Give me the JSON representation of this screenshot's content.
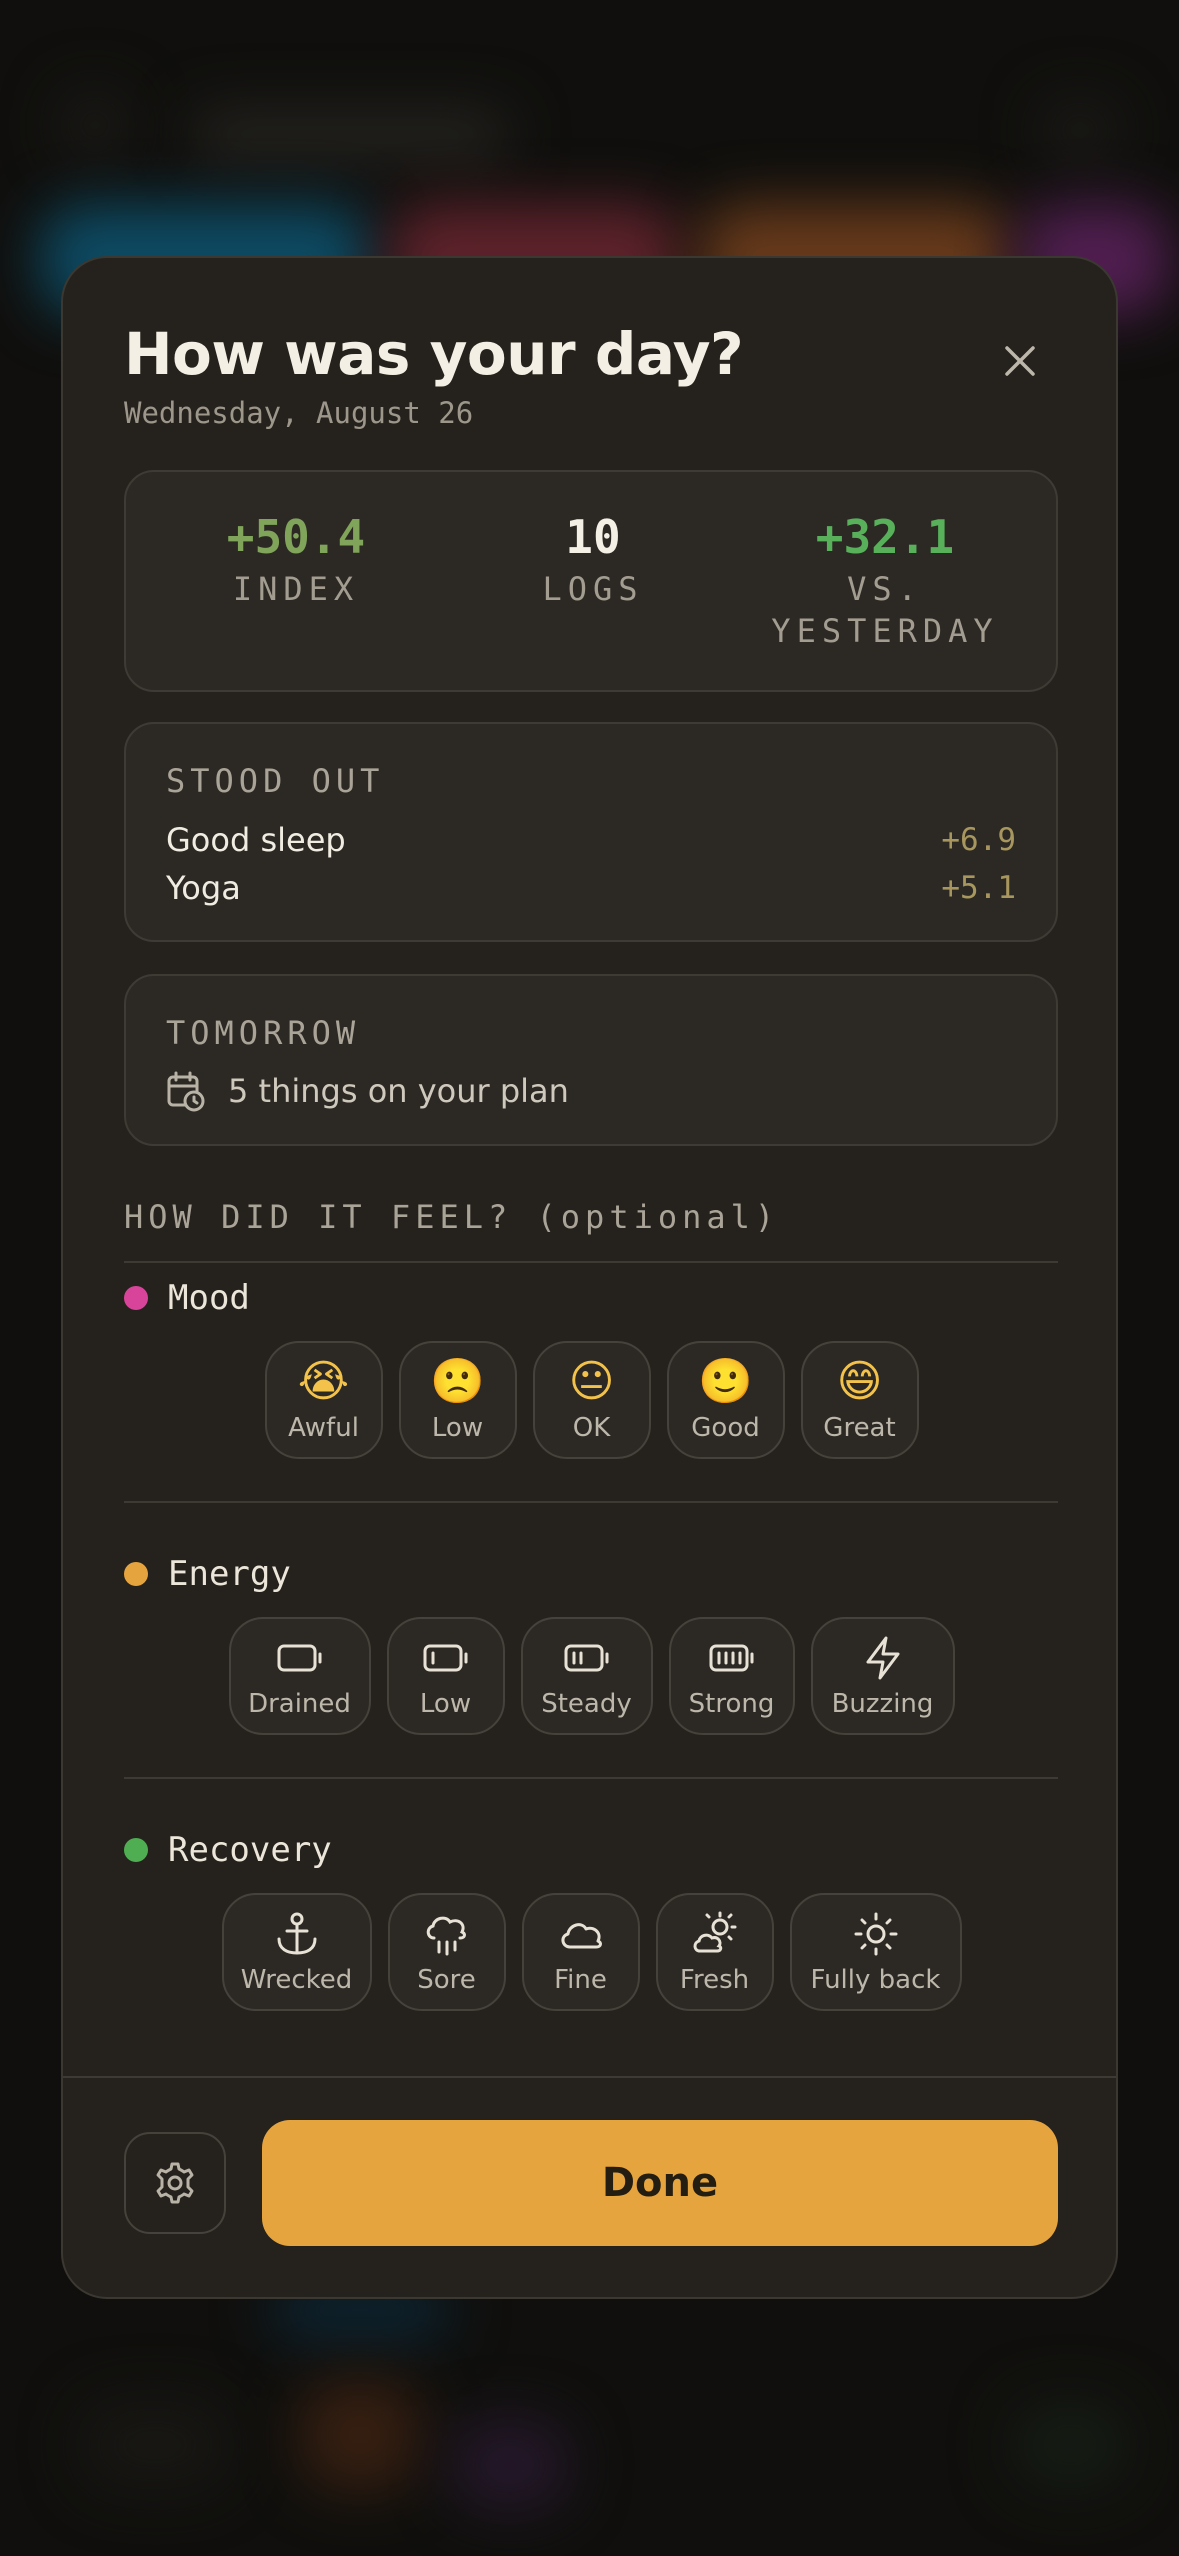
{
  "sheet": {
    "title": "How was your day?",
    "date": "Wednesday, August 26"
  },
  "stats": [
    {
      "value": "+50.4",
      "label": "INDEX",
      "color": "#7fa45a"
    },
    {
      "value": "10",
      "label": "LOGS",
      "color": "#f4f0e6"
    },
    {
      "value": "+32.1",
      "label": "VS.\nYESTERDAY",
      "color": "#58b05a"
    }
  ],
  "stood_out": {
    "label": "STOOD OUT",
    "items": [
      {
        "name": "Good sleep",
        "value": "+6.9"
      },
      {
        "name": "Yoga",
        "value": "+5.1"
      }
    ]
  },
  "tomorrow": {
    "label": "TOMORROW",
    "text": "5 things on your plan",
    "icon": "calendar-clock-icon"
  },
  "feel": {
    "label": "HOW DID IT FEEL? (optional)",
    "categories": [
      {
        "name": "Mood",
        "color": "#d9449b",
        "options": [
          {
            "label": "Awful",
            "glyph": "😭"
          },
          {
            "label": "Low",
            "glyph": "🙁"
          },
          {
            "label": "OK",
            "glyph": "😐"
          },
          {
            "label": "Good",
            "glyph": "🙂"
          },
          {
            "label": "Great",
            "glyph": "😄"
          }
        ]
      },
      {
        "name": "Energy",
        "color": "#e6a43e",
        "options": [
          {
            "label": "Drained",
            "icon": "battery-empty-icon"
          },
          {
            "label": "Low",
            "icon": "battery-low-icon"
          },
          {
            "label": "Steady",
            "icon": "battery-medium-icon"
          },
          {
            "label": "Strong",
            "icon": "battery-full-icon"
          },
          {
            "label": "Buzzing",
            "icon": "lightning-icon"
          }
        ]
      },
      {
        "name": "Recovery",
        "color": "#4fae52",
        "options": [
          {
            "label": "Wrecked",
            "icon": "anchor-icon"
          },
          {
            "label": "Sore",
            "icon": "rain-cloud-icon"
          },
          {
            "label": "Fine",
            "icon": "cloud-icon"
          },
          {
            "label": "Fresh",
            "icon": "sun-cloud-icon"
          },
          {
            "label": "Fully back",
            "icon": "sun-icon"
          }
        ]
      }
    ]
  },
  "footer": {
    "done_label": "Done",
    "settings_icon": "gear-icon",
    "accent": "#e6a43e"
  }
}
